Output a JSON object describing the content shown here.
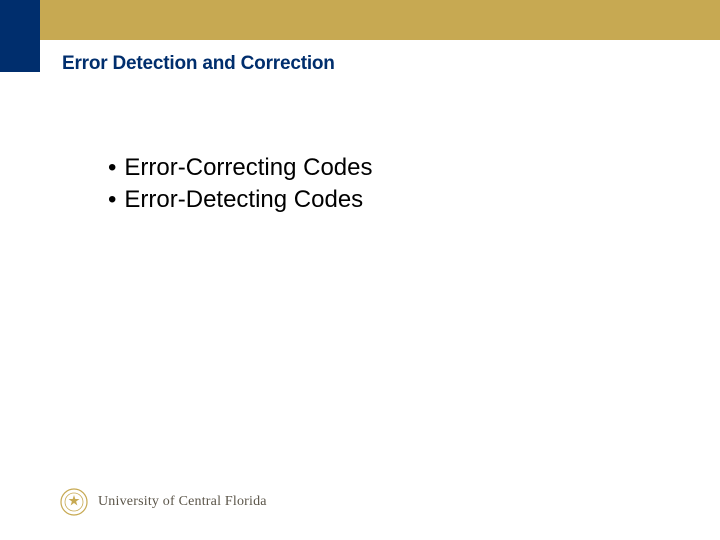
{
  "title": "Error Detection and Correction",
  "bullets": [
    "Error-Correcting Codes",
    "Error-Detecting Codes"
  ],
  "footer": {
    "institution": "University of Central Florida"
  },
  "colors": {
    "gold": "#c7a952",
    "blue": "#002e6d",
    "footer_text": "#5b5549"
  }
}
